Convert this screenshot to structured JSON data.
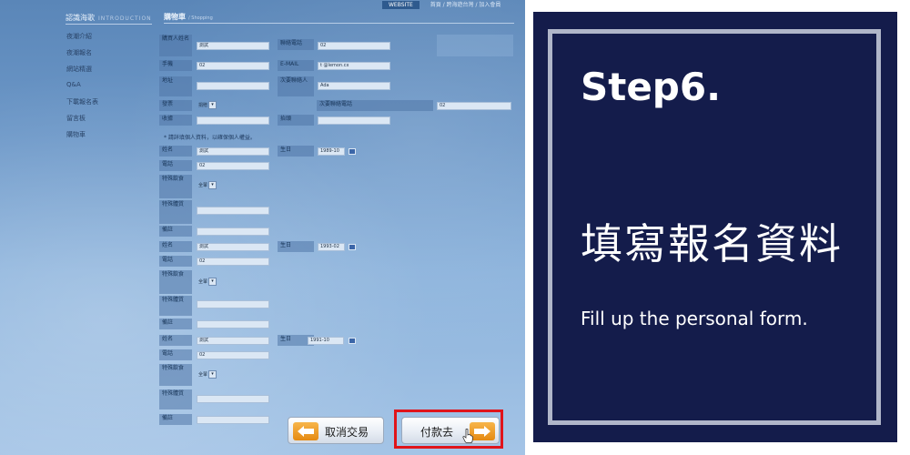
{
  "screenshot": {
    "top_nav": {
      "website_tag": "WEBSITE",
      "links": "首頁 / 跨海遊台灣 / 加入會員"
    },
    "sidebar": {
      "title": "認識海歌",
      "title_en": "INTRODUCTION",
      "items": [
        {
          "label": "夜潮介紹"
        },
        {
          "label": "夜潮報名"
        },
        {
          "label": "網站精選"
        },
        {
          "label": "Q&A"
        },
        {
          "label": "下載報名表"
        },
        {
          "label": "留言板"
        },
        {
          "label": "購物車"
        }
      ]
    },
    "main": {
      "title": "購物車",
      "title_en": "/ Shopping",
      "buyer": {
        "name_label": "購買人姓名",
        "name_value": "測試",
        "contact_phone_label": "聯絡電話",
        "contact_phone_value": "02",
        "mobile_label": "手機",
        "mobile_value": "02",
        "email_label": "E-MAIL",
        "email_value": "t        @lemon.cx",
        "address_label": "地址",
        "second_contact_label": "次要聯絡人",
        "second_contact_value": "Ada",
        "payment_label": "發票",
        "payment_value": "捐贈",
        "second_phone_label": "次要聯絡電話",
        "second_phone_value": "02",
        "receipt_label": "收據",
        "tax_id_label": "抬頭"
      },
      "note": "* 請詳填個人資料，以確保個人權益。",
      "participant_labels": {
        "name": "姓名",
        "birthday": "生日",
        "phone": "電話",
        "diet": "特殊飲食",
        "health": "特殊體質",
        "remarks": "備註"
      },
      "diet_option": "全葷",
      "participants": [
        {
          "name": "測試",
          "birthday": "1989-10",
          "phone": "02"
        },
        {
          "name": "測試",
          "birthday": "1993-02",
          "phone": "02"
        },
        {
          "name": "測試",
          "birthday": "1991-10",
          "phone": "02"
        }
      ],
      "buttons": {
        "cancel_label": "取消交易",
        "pay_label": "付款去"
      }
    }
  },
  "panel": {
    "step_title": "Step6.",
    "title_zh": "填寫報名資料",
    "subtitle_en": "Fill up the personal form."
  },
  "colors": {
    "panel_bg": "#141c4b",
    "frame_border": "#b0b6c9",
    "highlight_red": "#e0141a",
    "button_accent": "#f0a030"
  }
}
